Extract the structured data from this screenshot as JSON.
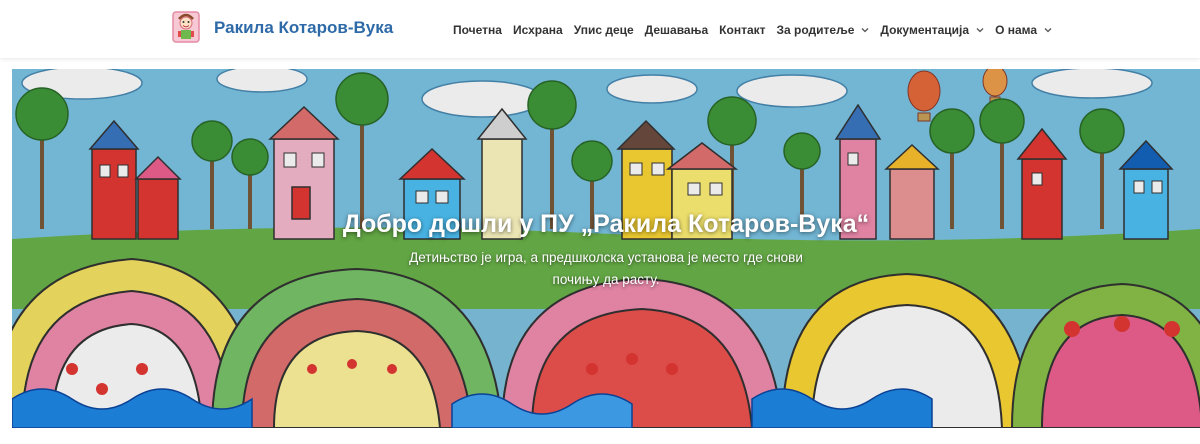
{
  "header": {
    "site_title": "Ракила Котаров-Вука",
    "logo_icon": "child-drawing-logo-icon",
    "nav": [
      {
        "label": "Почетна",
        "dropdown": false
      },
      {
        "label": "Исхрана",
        "dropdown": false
      },
      {
        "label": "Упис деце",
        "dropdown": false
      },
      {
        "label": "Дешавања",
        "dropdown": false
      },
      {
        "label": "Контакт",
        "dropdown": false
      },
      {
        "label": "За родитеље",
        "dropdown": true
      },
      {
        "label": "Документација",
        "dropdown": true
      },
      {
        "label": "О нама",
        "dropdown": true
      }
    ]
  },
  "hero": {
    "title": "Добро дошли у ПУ „Ракила Котаров-Вука“",
    "subtitle_line1": "Детињство је игра, а предшколска установа је место где снови",
    "subtitle_line2": "почињу да расту.",
    "image": "childrens-painting-houses-trees-rainbows"
  },
  "colors": {
    "brand": "#2e6aa7",
    "nav_text": "#333333",
    "hero_text": "#ffffff"
  }
}
